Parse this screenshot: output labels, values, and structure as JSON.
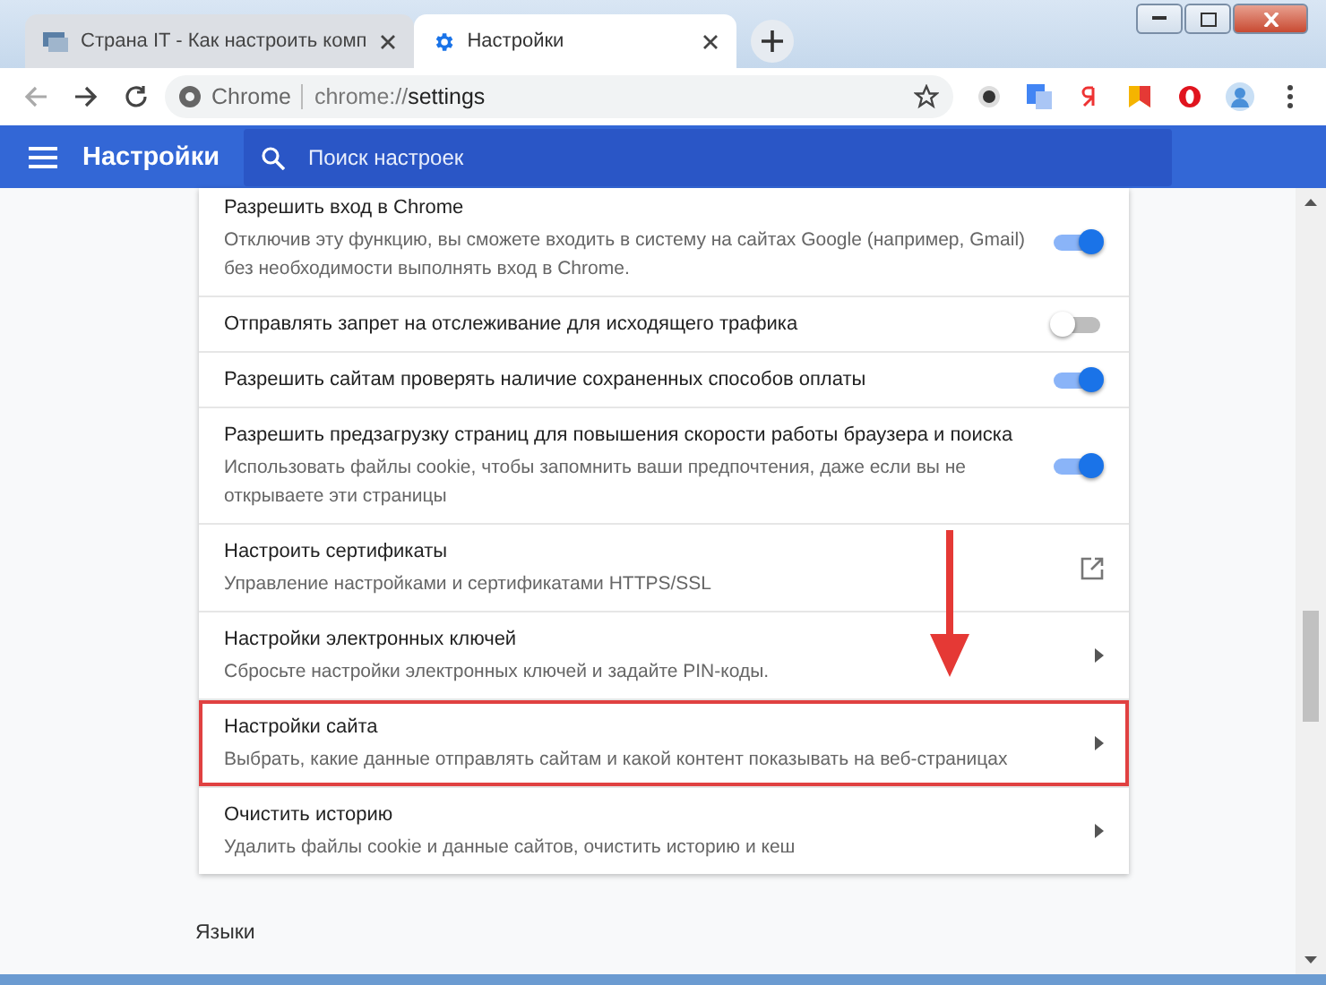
{
  "tabs": [
    {
      "title": "Страна IT - Как настроить комп",
      "selected": false
    },
    {
      "title": "Настройки",
      "selected": true
    }
  ],
  "address_bar": {
    "site_label": "Chrome",
    "scheme": "chrome://",
    "path": "settings"
  },
  "header": {
    "title": "Настройки",
    "search": {
      "placeholder": "Поиск настроек"
    }
  },
  "settings_rows": [
    {
      "kind": "toggle",
      "title": "Разрешить вход в Chrome",
      "description": "Отключив эту функцию, вы сможете входить в систему на сайтах Google (например, Gmail) без необходимости выполнять вход в Chrome.",
      "on": true,
      "highlighted": false
    },
    {
      "kind": "toggle",
      "title": "Отправлять запрет на отслеживание для исходящего трафика",
      "on": false,
      "highlighted": false
    },
    {
      "kind": "toggle",
      "title": "Разрешить сайтам проверять наличие сохраненных способов оплаты",
      "on": true,
      "highlighted": false
    },
    {
      "kind": "toggle",
      "title": "Разрешить предзагрузку страниц для повышения скорости работы браузера и поиска",
      "description": "Использовать файлы cookie, чтобы запомнить ваши предпочтения, даже если вы не открываете эти страницы",
      "on": true,
      "highlighted": false
    },
    {
      "kind": "external",
      "title": "Настроить сертификаты",
      "description": "Управление настройками и сертификатами HTTPS/SSL",
      "highlighted": false
    },
    {
      "kind": "arrow",
      "title": "Настройки электронных ключей",
      "description": "Сбросьте настройки электронных ключей и задайте PIN-коды.",
      "highlighted": false
    },
    {
      "kind": "arrow",
      "title": "Настройки сайта",
      "description": "Выбрать, какие данные отправлять сайтам и какой контент показывать на веб-страницах",
      "highlighted": true
    },
    {
      "kind": "arrow",
      "title": "Очистить историю",
      "description": "Удалить файлы cookie и данные сайтов, очистить историю и кеш",
      "highlighted": false
    }
  ],
  "next_section": {
    "title": "Языки"
  }
}
